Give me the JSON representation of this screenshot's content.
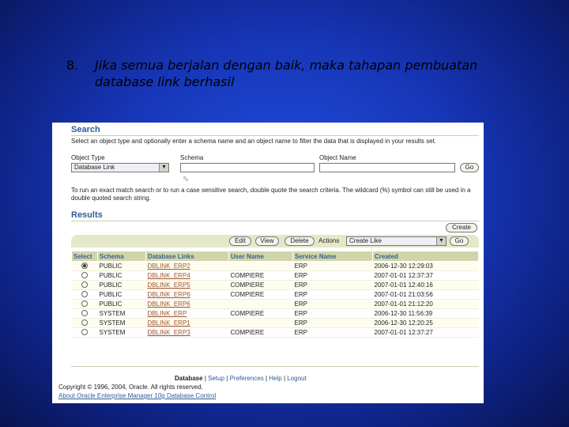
{
  "slide": {
    "number": "8.",
    "text": "Jika semua berjalan dengan baik, maka tahapan pembuatan database link berhasil"
  },
  "search": {
    "title": "Search",
    "instructions": "Select an object type and optionally enter a schema name and an object name to filter the data that is displayed in your results set.",
    "object_type_label": "Object Type",
    "object_type_value": "Database Link",
    "schema_label": "Schema",
    "object_name_label": "Object Name",
    "go_label": "Go",
    "tip": "To run an exact match search or to run a case sensitive search, double quote the search criteria. The wildcard (%) symbol can still be used in a double quoted search string."
  },
  "results": {
    "title": "Results",
    "create_label": "Create",
    "edit_label": "Edit",
    "view_label": "View",
    "delete_label": "Delete",
    "actions_label": "Actions",
    "actions_value": "Create Like",
    "go_label": "Go",
    "columns": [
      "Select",
      "Schema",
      "Database Links",
      "User Name",
      "Service Name",
      "Created"
    ],
    "rows": [
      {
        "schema": "PUBLIC",
        "link": "DBLINK_ERP2",
        "user": "",
        "service": "ERP",
        "created": "2006-12-30 12:29:03"
      },
      {
        "schema": "PUBLIC",
        "link": "DBLINK_ERP4",
        "user": "COMPIERE",
        "service": "ERP",
        "created": "2007-01-01 12:37:37"
      },
      {
        "schema": "PUBLIC",
        "link": "DBLINK_ERP5",
        "user": "COMPIERE",
        "service": "ERP",
        "created": "2007-01-01 12:40:16"
      },
      {
        "schema": "PUBLIC",
        "link": "DBLINK_ERP6",
        "user": "COMPIERE",
        "service": "ERP",
        "created": "2007-01-01 21:03:56"
      },
      {
        "schema": "PUBLIC",
        "link": "DBLINK_ERP6",
        "user": "",
        "service": "ERP",
        "created": "2007-01-01 21:12:20"
      },
      {
        "schema": "SYSTEM",
        "link": "DBLINK_ERP",
        "user": "COMPIERE",
        "service": "ERP",
        "created": "2006-12-30 11:56:39"
      },
      {
        "schema": "SYSTEM",
        "link": "DBLINK_ERP1",
        "user": "",
        "service": "ERP",
        "created": "2006-12-30 12:20:25"
      },
      {
        "schema": "SYSTEM",
        "link": "DBLINK_ERP3",
        "user": "COMPIERE",
        "service": "ERP",
        "created": "2007-01-01 12:37:27"
      }
    ]
  },
  "footer": {
    "database": "Database",
    "setup": "Setup",
    "preferences": "Preferences",
    "help": "Help",
    "logout": "Logout",
    "copyright": "Copyright © 1996, 2004, Oracle. All rights reserved.",
    "about": "About Oracle Enterprise Manager 10g Database Control"
  }
}
